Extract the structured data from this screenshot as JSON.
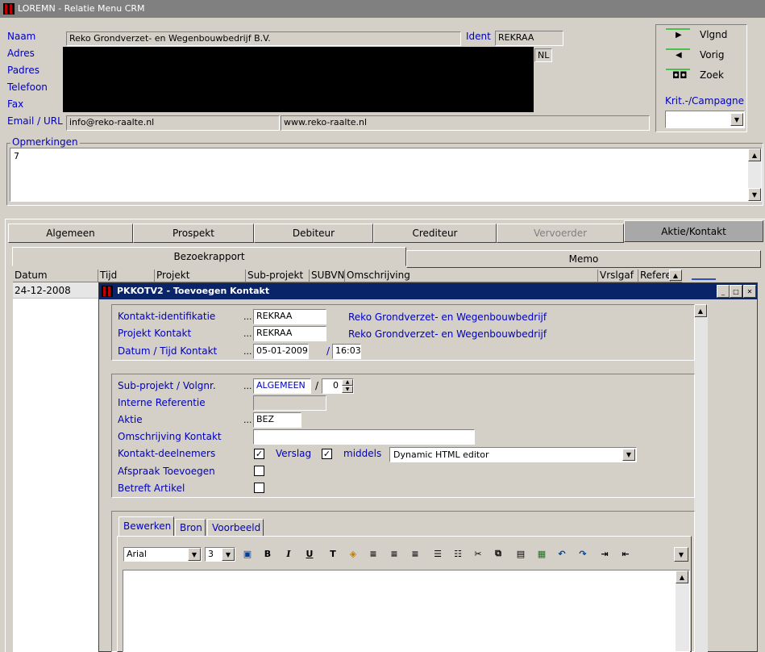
{
  "window": {
    "title": "LOREMN - Relatie Menu CRM"
  },
  "relation": {
    "labels": {
      "naam": "Naam",
      "adres": "Adres",
      "padres": "Padres",
      "telefoon": "Telefoon",
      "fax": "Fax",
      "email_url": "Email / URL",
      "ident": "Ident"
    },
    "naam_value": "Reko Grondverzet- en Wegenbouwbedrijf B.V.",
    "ident_value": "REKRAA",
    "country": "NL",
    "email_value": "info@reko-raalte.nl",
    "url_value": "www.reko-raalte.nl"
  },
  "nav": {
    "next_label": "Vlgnd",
    "prev_label": "Vorig",
    "search_label": "Zoek",
    "campaign_label": "Krit.-/Campagne"
  },
  "remarks": {
    "legend": "Opmerkingen",
    "value": "7"
  },
  "tabs": [
    "Algemeen",
    "Prospekt",
    "Debiteur",
    "Crediteur",
    "Vervoerder",
    "Aktie/Kontakt"
  ],
  "subtabs": [
    "Bezoekrapport",
    "Memo"
  ],
  "columns": [
    "Datum",
    "Tijd",
    "Projekt",
    "Sub-projekt",
    "SUBVN",
    "Omschrijving",
    "Vrslgaf",
    "Refere"
  ],
  "rows": [
    {
      "datum": "24-12-2008"
    }
  ],
  "dialog": {
    "title": "PKKOTV2 - Toevoegen Kontakt",
    "kontakt_id_label": "Kontakt-identifikatie",
    "kontakt_id_value": "REKRAA",
    "kontakt_id_name": "Reko Grondverzet- en Wegenbouwbedrijf",
    "projekt_label": "Projekt Kontakt",
    "projekt_value": "REKRAA",
    "projekt_name": "Reko Grondverzet- en Wegenbouwbedrijf",
    "datum_label": "Datum / Tijd Kontakt",
    "datum_value": "05-01-2009",
    "slash": "/",
    "tijd_value": "16:03",
    "subprojekt_label": "Sub-projekt / Volgnr.",
    "subprojekt_value": "ALGEMEEN",
    "volgnr_value": "0",
    "interne_label": "Interne Referentie",
    "aktie_label": "Aktie",
    "aktie_value": "BEZ",
    "omschrijving_label": "Omschrijving Kontakt",
    "deelnemers_label": "Kontakt-deelnemers",
    "verslag_label": "Verslag",
    "middels_label": "middels",
    "middels_value": "Dynamic HTML editor",
    "afspraak_label": "Afspraak Toevoegen",
    "artikel_label": "Betreft Artikel",
    "dots": "...",
    "editor_tabs": [
      "Bewerken",
      "Bron",
      "Voorbeeld"
    ],
    "font_value": "Arial",
    "size_value": "3"
  }
}
